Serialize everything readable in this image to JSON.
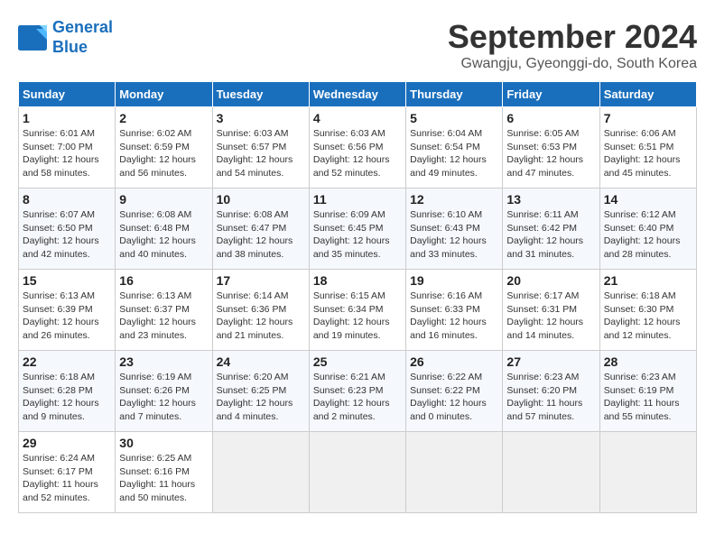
{
  "logo": {
    "line1": "General",
    "line2": "Blue"
  },
  "title": "September 2024",
  "location": "Gwangju, Gyeonggi-do, South Korea",
  "headers": [
    "Sunday",
    "Monday",
    "Tuesday",
    "Wednesday",
    "Thursday",
    "Friday",
    "Saturday"
  ],
  "weeks": [
    [
      {
        "day": "1",
        "sunrise": "6:01 AM",
        "sunset": "7:00 PM",
        "daylight": "12 hours and 58 minutes."
      },
      {
        "day": "2",
        "sunrise": "6:02 AM",
        "sunset": "6:59 PM",
        "daylight": "12 hours and 56 minutes."
      },
      {
        "day": "3",
        "sunrise": "6:03 AM",
        "sunset": "6:57 PM",
        "daylight": "12 hours and 54 minutes."
      },
      {
        "day": "4",
        "sunrise": "6:03 AM",
        "sunset": "6:56 PM",
        "daylight": "12 hours and 52 minutes."
      },
      {
        "day": "5",
        "sunrise": "6:04 AM",
        "sunset": "6:54 PM",
        "daylight": "12 hours and 49 minutes."
      },
      {
        "day": "6",
        "sunrise": "6:05 AM",
        "sunset": "6:53 PM",
        "daylight": "12 hours and 47 minutes."
      },
      {
        "day": "7",
        "sunrise": "6:06 AM",
        "sunset": "6:51 PM",
        "daylight": "12 hours and 45 minutes."
      }
    ],
    [
      {
        "day": "8",
        "sunrise": "6:07 AM",
        "sunset": "6:50 PM",
        "daylight": "12 hours and 42 minutes."
      },
      {
        "day": "9",
        "sunrise": "6:08 AM",
        "sunset": "6:48 PM",
        "daylight": "12 hours and 40 minutes."
      },
      {
        "day": "10",
        "sunrise": "6:08 AM",
        "sunset": "6:47 PM",
        "daylight": "12 hours and 38 minutes."
      },
      {
        "day": "11",
        "sunrise": "6:09 AM",
        "sunset": "6:45 PM",
        "daylight": "12 hours and 35 minutes."
      },
      {
        "day": "12",
        "sunrise": "6:10 AM",
        "sunset": "6:43 PM",
        "daylight": "12 hours and 33 minutes."
      },
      {
        "day": "13",
        "sunrise": "6:11 AM",
        "sunset": "6:42 PM",
        "daylight": "12 hours and 31 minutes."
      },
      {
        "day": "14",
        "sunrise": "6:12 AM",
        "sunset": "6:40 PM",
        "daylight": "12 hours and 28 minutes."
      }
    ],
    [
      {
        "day": "15",
        "sunrise": "6:13 AM",
        "sunset": "6:39 PM",
        "daylight": "12 hours and 26 minutes."
      },
      {
        "day": "16",
        "sunrise": "6:13 AM",
        "sunset": "6:37 PM",
        "daylight": "12 hours and 23 minutes."
      },
      {
        "day": "17",
        "sunrise": "6:14 AM",
        "sunset": "6:36 PM",
        "daylight": "12 hours and 21 minutes."
      },
      {
        "day": "18",
        "sunrise": "6:15 AM",
        "sunset": "6:34 PM",
        "daylight": "12 hours and 19 minutes."
      },
      {
        "day": "19",
        "sunrise": "6:16 AM",
        "sunset": "6:33 PM",
        "daylight": "12 hours and 16 minutes."
      },
      {
        "day": "20",
        "sunrise": "6:17 AM",
        "sunset": "6:31 PM",
        "daylight": "12 hours and 14 minutes."
      },
      {
        "day": "21",
        "sunrise": "6:18 AM",
        "sunset": "6:30 PM",
        "daylight": "12 hours and 12 minutes."
      }
    ],
    [
      {
        "day": "22",
        "sunrise": "6:18 AM",
        "sunset": "6:28 PM",
        "daylight": "12 hours and 9 minutes."
      },
      {
        "day": "23",
        "sunrise": "6:19 AM",
        "sunset": "6:26 PM",
        "daylight": "12 hours and 7 minutes."
      },
      {
        "day": "24",
        "sunrise": "6:20 AM",
        "sunset": "6:25 PM",
        "daylight": "12 hours and 4 minutes."
      },
      {
        "day": "25",
        "sunrise": "6:21 AM",
        "sunset": "6:23 PM",
        "daylight": "12 hours and 2 minutes."
      },
      {
        "day": "26",
        "sunrise": "6:22 AM",
        "sunset": "6:22 PM",
        "daylight": "12 hours and 0 minutes."
      },
      {
        "day": "27",
        "sunrise": "6:23 AM",
        "sunset": "6:20 PM",
        "daylight": "11 hours and 57 minutes."
      },
      {
        "day": "28",
        "sunrise": "6:23 AM",
        "sunset": "6:19 PM",
        "daylight": "11 hours and 55 minutes."
      }
    ],
    [
      {
        "day": "29",
        "sunrise": "6:24 AM",
        "sunset": "6:17 PM",
        "daylight": "11 hours and 52 minutes."
      },
      {
        "day": "30",
        "sunrise": "6:25 AM",
        "sunset": "6:16 PM",
        "daylight": "11 hours and 50 minutes."
      },
      {
        "day": "",
        "sunrise": "",
        "sunset": "",
        "daylight": ""
      },
      {
        "day": "",
        "sunrise": "",
        "sunset": "",
        "daylight": ""
      },
      {
        "day": "",
        "sunrise": "",
        "sunset": "",
        "daylight": ""
      },
      {
        "day": "",
        "sunrise": "",
        "sunset": "",
        "daylight": ""
      },
      {
        "day": "",
        "sunrise": "",
        "sunset": "",
        "daylight": ""
      }
    ]
  ]
}
